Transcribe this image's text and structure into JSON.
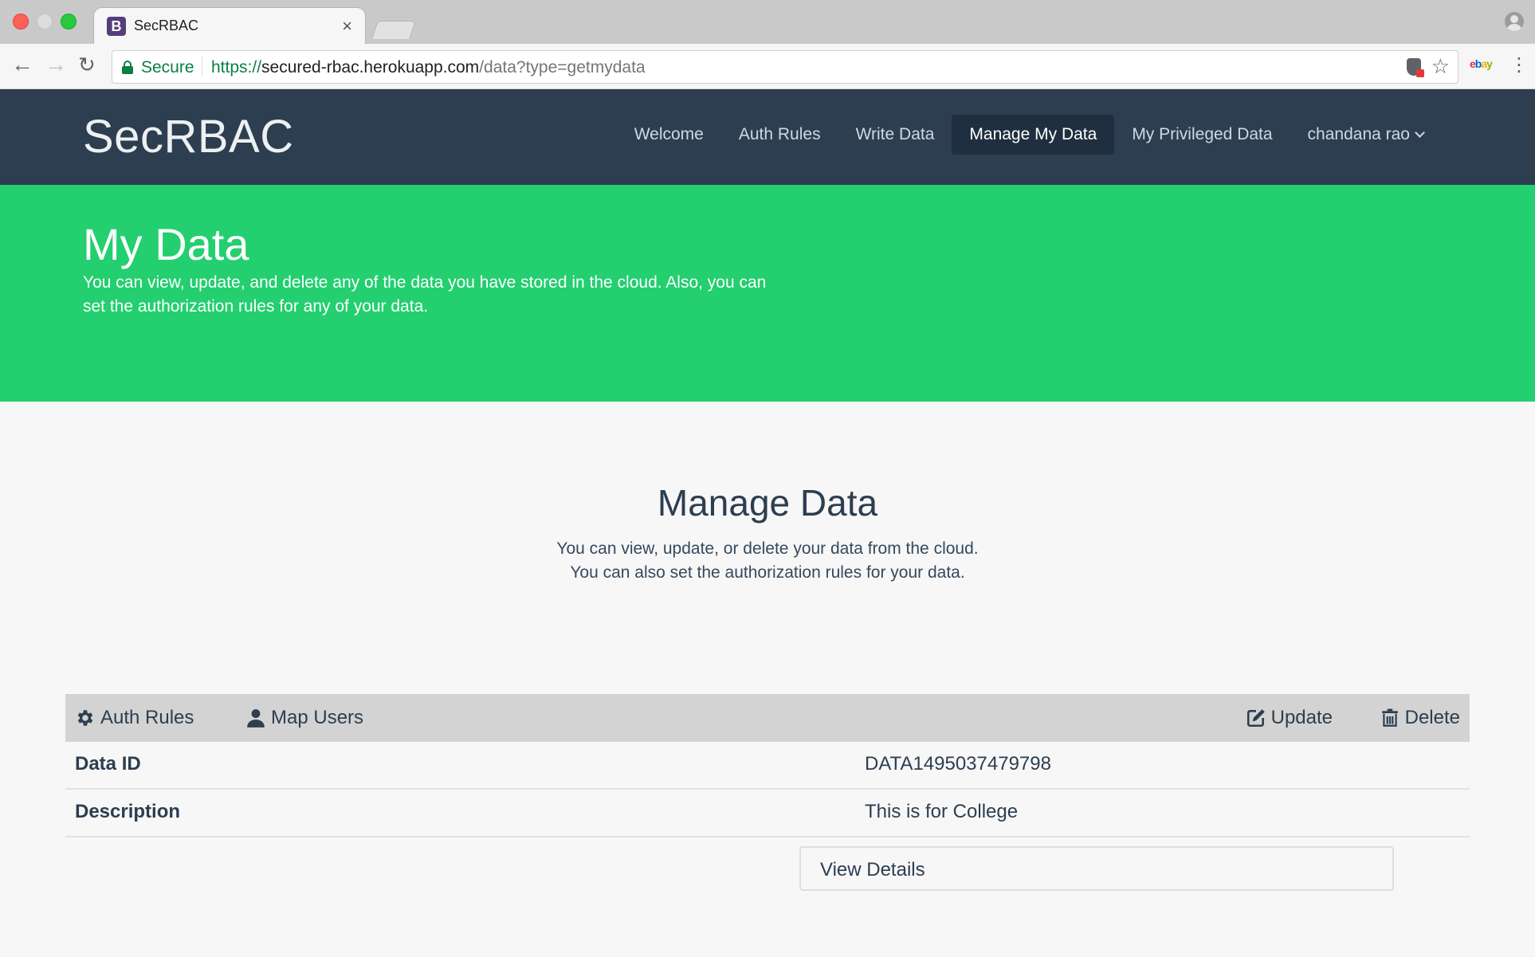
{
  "browser": {
    "tab_title": "SecRBAC",
    "tab_favicon_letter": "B",
    "tab_close": "×",
    "secure_label": "Secure",
    "url_scheme": "https://",
    "url_host": "secured-rbac.herokuapp.com",
    "url_path": "/data?type=getmydata"
  },
  "navbar": {
    "brand": "SecRBAC",
    "items": [
      {
        "label": "Welcome",
        "active": false
      },
      {
        "label": "Auth Rules",
        "active": false
      },
      {
        "label": "Write Data",
        "active": false
      },
      {
        "label": "Manage My Data",
        "active": true
      },
      {
        "label": "My Privileged Data",
        "active": false
      }
    ],
    "user_menu": "chandana rao"
  },
  "hero": {
    "title": "My Data",
    "text": "You can view, update, and delete any of the data you have stored in the cloud. Also, you can set the authorization rules for any of your data."
  },
  "section": {
    "title": "Manage Data",
    "line1": "You can view, update, or delete your data from the cloud.",
    "line2": "You can also set the authorization rules for your data."
  },
  "panel": {
    "actions": {
      "auth_rules": "Auth Rules",
      "map_users": "Map Users",
      "update": "Update",
      "delete": "Delete"
    },
    "rows": [
      {
        "label": "Data ID",
        "value": "DATA1495037479798"
      },
      {
        "label": "Description",
        "value": "This is for College"
      }
    ],
    "view_details": "View Details"
  },
  "colors": {
    "navbar": "#2c3e50",
    "hero": "#23cf6f",
    "page_bg": "#f7f7f7",
    "action_bar": "#d3d3d3"
  }
}
